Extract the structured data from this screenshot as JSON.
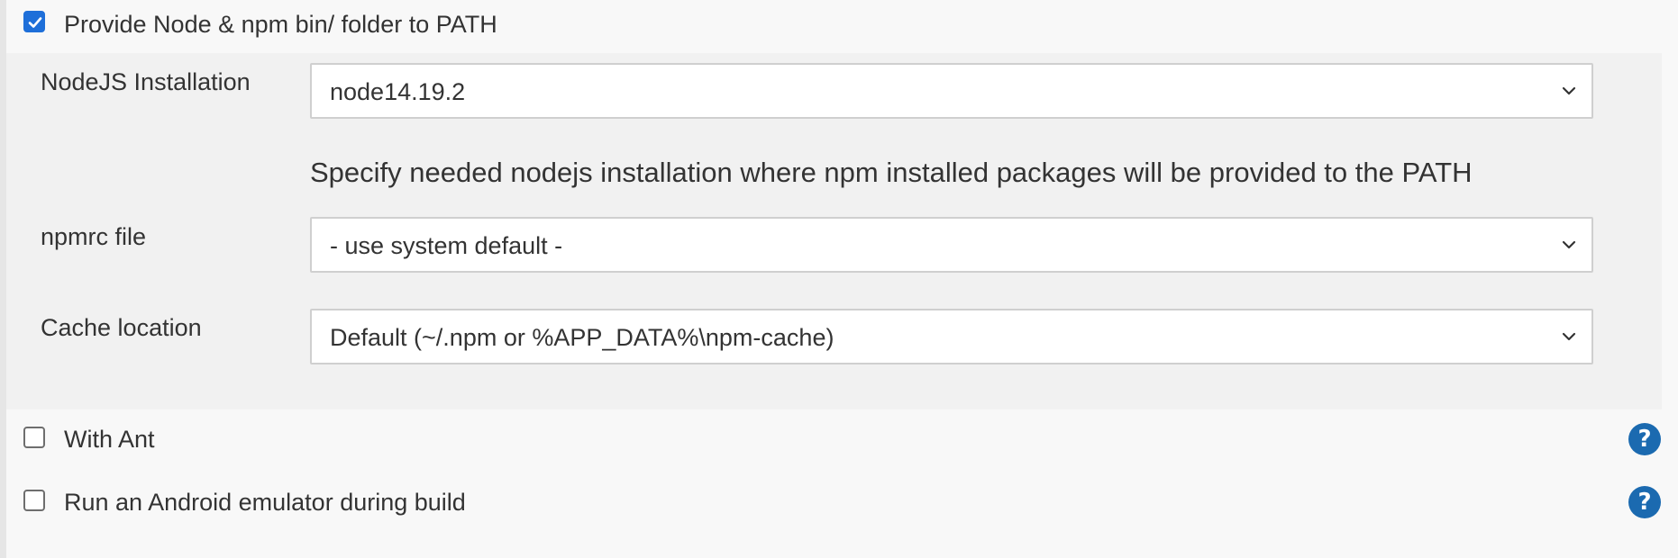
{
  "provide_node": {
    "label": "Provide Node & npm bin/ folder to PATH",
    "checked": true
  },
  "nodejs_installation": {
    "label": "NodeJS Installation",
    "value": "node14.19.2",
    "hint": "Specify needed nodejs installation where npm installed packages will be provided to the PATH"
  },
  "npmrc": {
    "label": "npmrc file",
    "value": "- use system default -"
  },
  "cache_location": {
    "label": "Cache location",
    "value": "Default (~/.npm or %APP_DATA%\\npm-cache)"
  },
  "with_ant": {
    "label": "With Ant",
    "checked": false,
    "help_icon": "?"
  },
  "android_emulator": {
    "label": "Run an Android emulator during build",
    "checked": false,
    "help_icon": "?"
  },
  "colors": {
    "accent": "#1e6fd9",
    "help": "#1b6ab0",
    "panel": "#f1f1f1",
    "background": "#f8f8f8"
  }
}
